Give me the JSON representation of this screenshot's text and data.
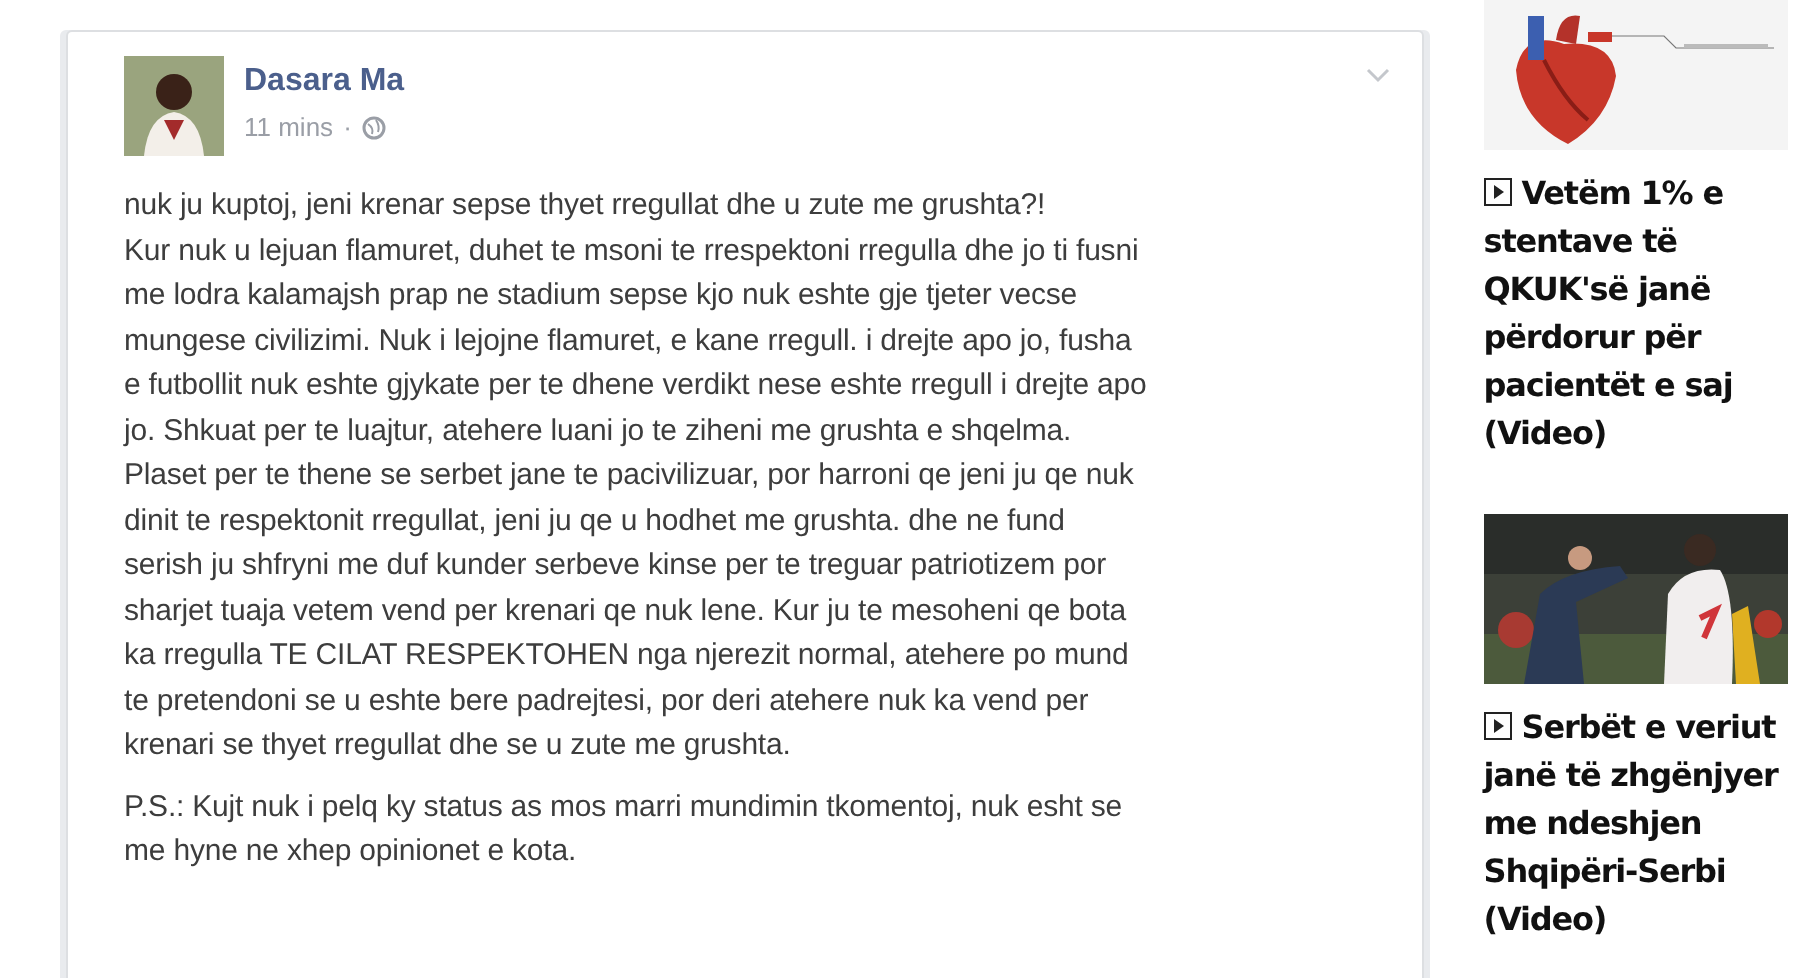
{
  "post": {
    "author": "Dasara Ma",
    "time": "11 mins",
    "separator": "·",
    "paragraphs": [
      [
        "nuk ju kuptoj, jeni krenar sepse thyet rregullat dhe u zute me grushta?!",
        "Kur nuk u lejuan flamuret, duhet te msoni te rrespektoni rregulla dhe jo ti fusni",
        "me lodra kalamajsh prap ne stadium sepse kjo nuk eshte gje tjeter vecse",
        "mungese civilizimi. Nuk i lejojne flamuret, e kane rregull. i drejte apo jo, fusha",
        "e futbollit nuk eshte gjykate per te dhene verdikt nese eshte rregull i drejte apo",
        "jo. Shkuat per te luajtur, atehere luani jo te ziheni me grushta e shqelma.",
        "Plaset per te thene se serbet jane te pacivilizuar, por harroni qe jeni ju qe nuk",
        "dinit te respektonit rregullat, jeni ju qe u hodhet me grushta. dhe ne fund",
        "serish ju shfryni me duf kunder serbeve kinse per te treguar patriotizem por",
        "sharjet tuaja vetem vend per krenari qe nuk lene. Kur ju te mesoheni qe bota",
        "ka rregulla TE CILAT RESPEKTOHEN nga njerezit normal, atehere po mund",
        "te pretendoni se u eshte bere padrejtesi, por deri atehere nuk ka vend per",
        "krenari se thyet rregullat dhe se u zute me grushta."
      ],
      [
        "P.S.: Kujt nuk i pelq ky status as mos marri mundimin tkomentoj, nuk esht se",
        "me hyne ne xhep opinionet e kota."
      ]
    ]
  },
  "sidebar": [
    {
      "kind": "heart",
      "title": "Vetëm 1% e stentave të QKUK'së janë përdorur për pacientët e saj (Video)"
    },
    {
      "kind": "picture",
      "title": "Serbët e veriut janë të zhgënjyer me ndeshjen Shqipëri-Serbi (Video)"
    }
  ]
}
